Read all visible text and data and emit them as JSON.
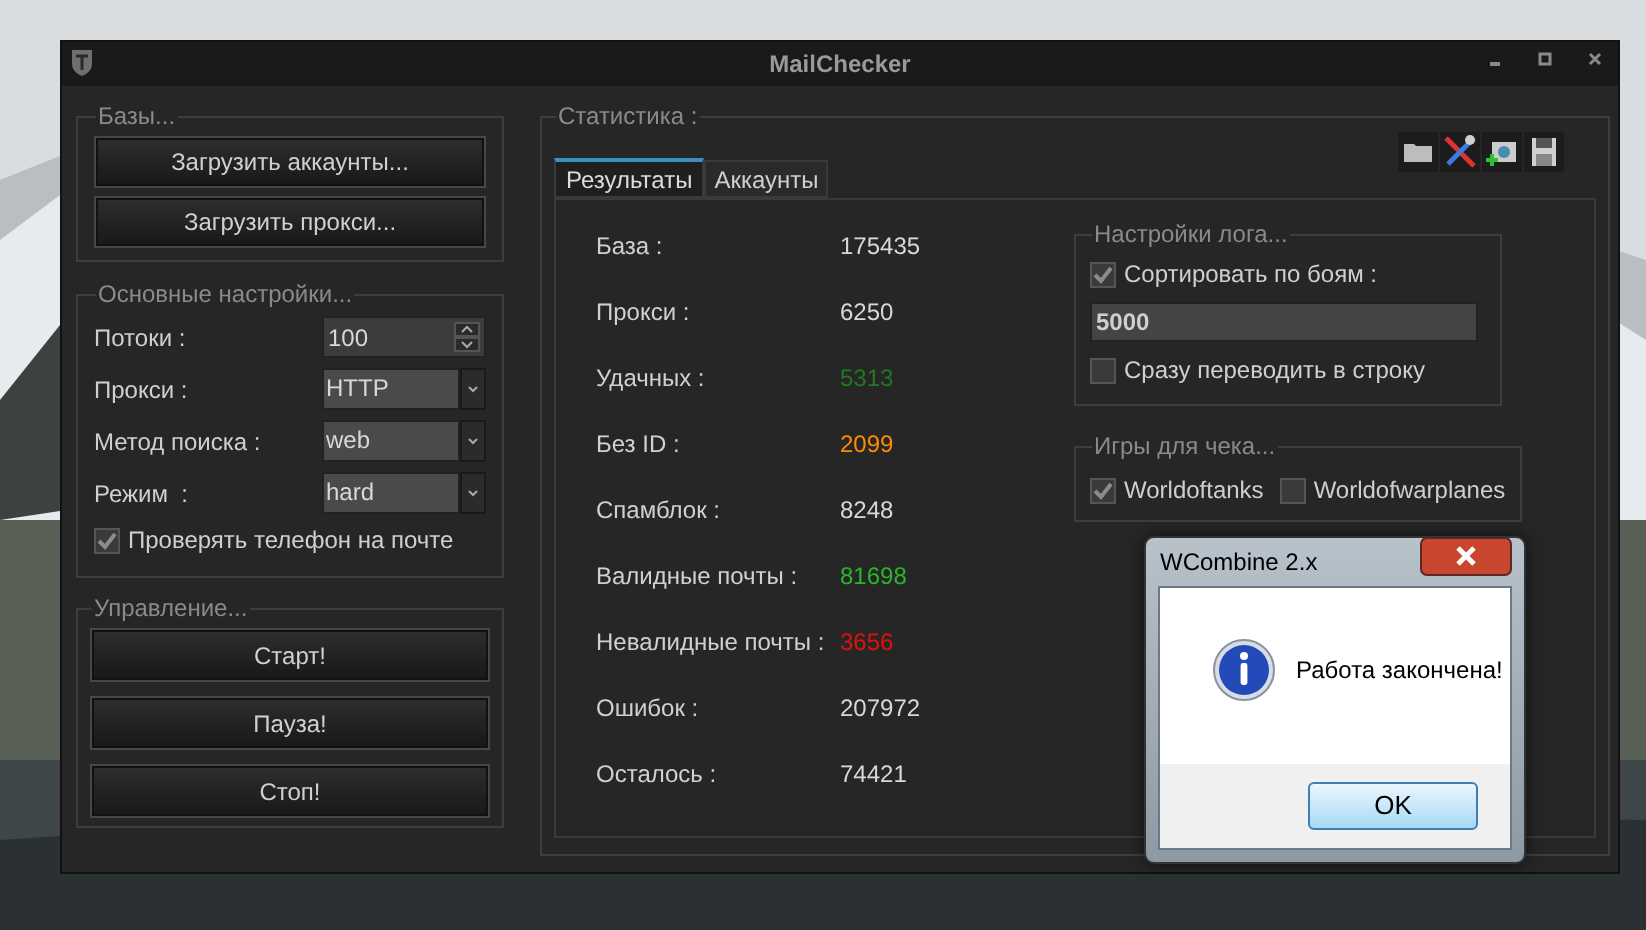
{
  "window": {
    "title": "MailChecker"
  },
  "bases": {
    "title": "Базы...",
    "buttons": [
      "Загрузить аккаунты...",
      "Загрузить прокси..."
    ]
  },
  "settings": {
    "title": "Основные настройки...",
    "fields": [
      {
        "kind": "spinner",
        "label": "Потоки :",
        "value": "100"
      },
      {
        "kind": "dropdown",
        "label": "Прокси :",
        "value": "HTTP"
      },
      {
        "kind": "dropdown",
        "label": "Метод поиска :",
        "value": "web"
      },
      {
        "kind": "dropdown",
        "label": "Режим  :",
        "value": "hard"
      }
    ],
    "check": {
      "label": "Проверять телефон на почте",
      "checked": true
    }
  },
  "control": {
    "title": "Управление...",
    "buttons": [
      "Старт!",
      "Пауза!",
      "Стоп!"
    ]
  },
  "stats": {
    "title": "Статистика :",
    "tabs": [
      {
        "label": "Результаты",
        "selected": true
      },
      {
        "label": "Аккаунты",
        "selected": false
      }
    ],
    "rows": [
      {
        "label": "База :",
        "value": "175435",
        "color": "#d8d8d8"
      },
      {
        "label": "Прокси :",
        "value": "6250",
        "color": "#d8d8d8"
      },
      {
        "label": "Удачных :",
        "value": "5313",
        "color": "#1f7a1f"
      },
      {
        "label": "Без ID :",
        "value": "2099",
        "color": "#ff8c00"
      },
      {
        "label": "Спамблок :",
        "value": "8248",
        "color": "#d8d8d8"
      },
      {
        "label": "Валидные почты :",
        "value": "81698",
        "color": "#2bb52b"
      },
      {
        "label": "Невалидные почты :",
        "value": "3656",
        "color": "#e01010"
      },
      {
        "label": "Ошибок :",
        "value": "207972",
        "color": "#d8d8d8"
      },
      {
        "label": "Осталось :",
        "value": "74421",
        "color": "#d8d8d8"
      }
    ]
  },
  "log_settings": {
    "title": "Настройки лога...",
    "sort": {
      "label": "Сортировать по боям :",
      "checked": true
    },
    "value": "5000",
    "inline": {
      "label": "Сразу переводить в строку",
      "checked": false
    }
  },
  "games": {
    "title": "Игры для чека...",
    "items": [
      {
        "label": "Worldoftanks",
        "checked": true
      },
      {
        "label": "Worldofwarplanes",
        "checked": false
      }
    ]
  },
  "dialog": {
    "title": "WCombine 2.x",
    "message": "Работа закончена!",
    "button": "OK"
  }
}
